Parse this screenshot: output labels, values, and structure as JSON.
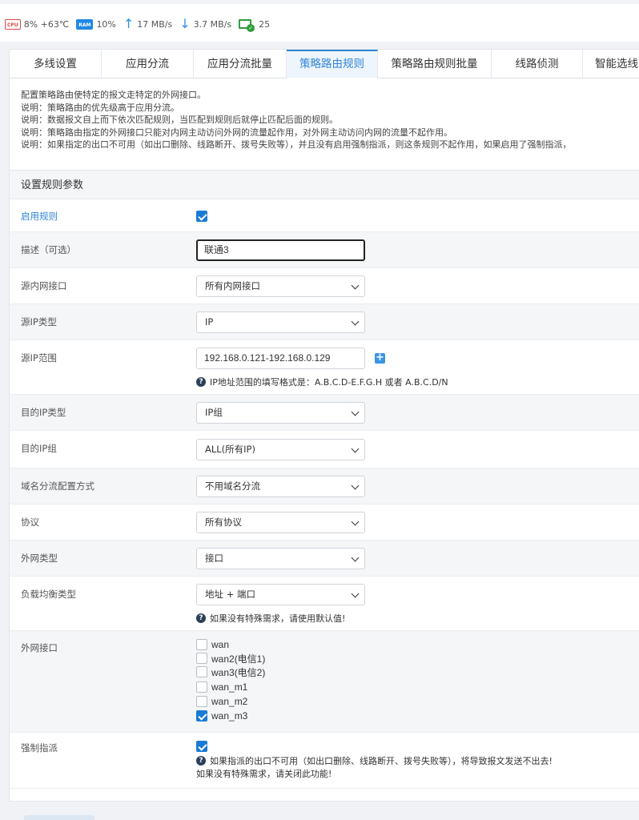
{
  "status": {
    "cpu_chip": "CPU",
    "cpu_text": "8% +63℃",
    "ram_chip": "RAM",
    "ram_text": "10%",
    "up_text": "17 MB/s",
    "down_text": "3.7 MB/s",
    "devices_text": "25"
  },
  "tabs": [
    {
      "label": "多线设置"
    },
    {
      "label": "应用分流"
    },
    {
      "label": "应用分流批量"
    },
    {
      "label": "策略路由规则",
      "active": true
    },
    {
      "label": "策略路由规则批量"
    },
    {
      "label": "线路侦测"
    },
    {
      "label": "智能选线"
    }
  ],
  "notes": [
    "配置策略路由使特定的报文走特定的外网接口。",
    "说明：策略路由的优先级高于应用分流。",
    "说明：数据报文自上而下依次匹配规则，当匹配到规则后就停止匹配后面的规则。",
    "说明：策略路由指定的外网接口只能对内网主动访问外网的流量起作用，对外网主动访问内网的流量不起作用。",
    "说明：如果指定的出口不可用（如出口删除、线路断开、拨号失败等），并且没有启用强制指派，则这条规则不起作用，如果启用了强制指派，"
  ],
  "section_title": "设置规则参数",
  "form": {
    "enable": {
      "label": "启用规则",
      "checked": true
    },
    "desc": {
      "label": "描述（可选）",
      "value": "联通3"
    },
    "src_iface": {
      "label": "源内网接口",
      "value": "所有内网接口"
    },
    "src_ip_type": {
      "label": "源IP类型",
      "value": "IP"
    },
    "src_ip_range": {
      "label": "源IP范围",
      "value": "192.168.0.121-192.168.0.129",
      "help": "IP地址范围的填写格式是：A.B.C.D-E.F.G.H 或者 A.B.C.D/N"
    },
    "dst_ip_type": {
      "label": "目的IP类型",
      "value": "IP组"
    },
    "dst_ip_group": {
      "label": "目的IP组",
      "value": "ALL(所有IP)"
    },
    "domain_mode": {
      "label": "域名分流配置方式",
      "value": "不用域名分流"
    },
    "protocol": {
      "label": "协议",
      "value": "所有协议"
    },
    "wan_type": {
      "label": "外网类型",
      "value": "接口"
    },
    "lb_type": {
      "label": "负载均衡类型",
      "value": "地址 + 端口",
      "help": "如果没有特殊需求，请使用默认值!"
    },
    "wan_iface": {
      "label": "外网接口",
      "options": [
        {
          "label": "wan",
          "checked": false
        },
        {
          "label": "wan2(电信1)",
          "checked": false
        },
        {
          "label": "wan3(电信2)",
          "checked": false
        },
        {
          "label": "wan_m1",
          "checked": false
        },
        {
          "label": "wan_m2",
          "checked": false
        },
        {
          "label": "wan_m3",
          "checked": true
        }
      ]
    },
    "force": {
      "label": "强制指派",
      "checked": true,
      "help1": "如果指派的出口不可用（如出口删除、线路断开、拨号失败等），将导致报文发送不出去!",
      "help2": "如果没有特殊需求，请关闭此功能!"
    }
  },
  "icons": {
    "upload": "arrow-up-icon",
    "download": "arrow-down-icon",
    "devices": "device-online-icon",
    "help": "question-circle-icon",
    "add": "plus-icon",
    "dropdown": "chevron-down-icon"
  },
  "colors": {
    "accent": "#2f84d6",
    "checkbox": "#1a7bd4"
  }
}
